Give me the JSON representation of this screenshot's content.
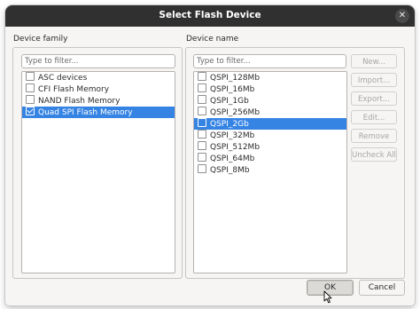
{
  "window": {
    "title": "Select Flash Device"
  },
  "device_family": {
    "label": "Device family",
    "filter_placeholder": "Type to filter...",
    "items": [
      {
        "label": "ASC devices",
        "checked": false,
        "selected": false
      },
      {
        "label": "CFI Flash Memory",
        "checked": false,
        "selected": false
      },
      {
        "label": "NAND Flash Memory",
        "checked": false,
        "selected": false
      },
      {
        "label": "Quad SPI Flash Memory",
        "checked": true,
        "selected": true
      }
    ]
  },
  "device_name": {
    "label": "Device name",
    "filter_placeholder": "Type to filter...",
    "items": [
      {
        "label": "QSPI_128Mb",
        "checked": false,
        "selected": false
      },
      {
        "label": "QSPI_16Mb",
        "checked": false,
        "selected": false
      },
      {
        "label": "QSPI_1Gb",
        "checked": false,
        "selected": false
      },
      {
        "label": "QSPI_256Mb",
        "checked": false,
        "selected": false
      },
      {
        "label": "QSPI_2Gb",
        "checked": false,
        "selected": true
      },
      {
        "label": "QSPI_32Mb",
        "checked": false,
        "selected": false
      },
      {
        "label": "QSPI_512Mb",
        "checked": false,
        "selected": false
      },
      {
        "label": "QSPI_64Mb",
        "checked": false,
        "selected": false
      },
      {
        "label": "QSPI_8Mb",
        "checked": false,
        "selected": false
      }
    ]
  },
  "side_buttons": {
    "new": "New...",
    "import": "Import...",
    "export": "Export...",
    "edit": "Edit...",
    "remove": "Remove",
    "uncheck_all": "Uncheck All"
  },
  "footer": {
    "ok": "OK",
    "cancel": "Cancel"
  },
  "colors": {
    "selection": "#3584e4",
    "titlebar": "#303030"
  }
}
